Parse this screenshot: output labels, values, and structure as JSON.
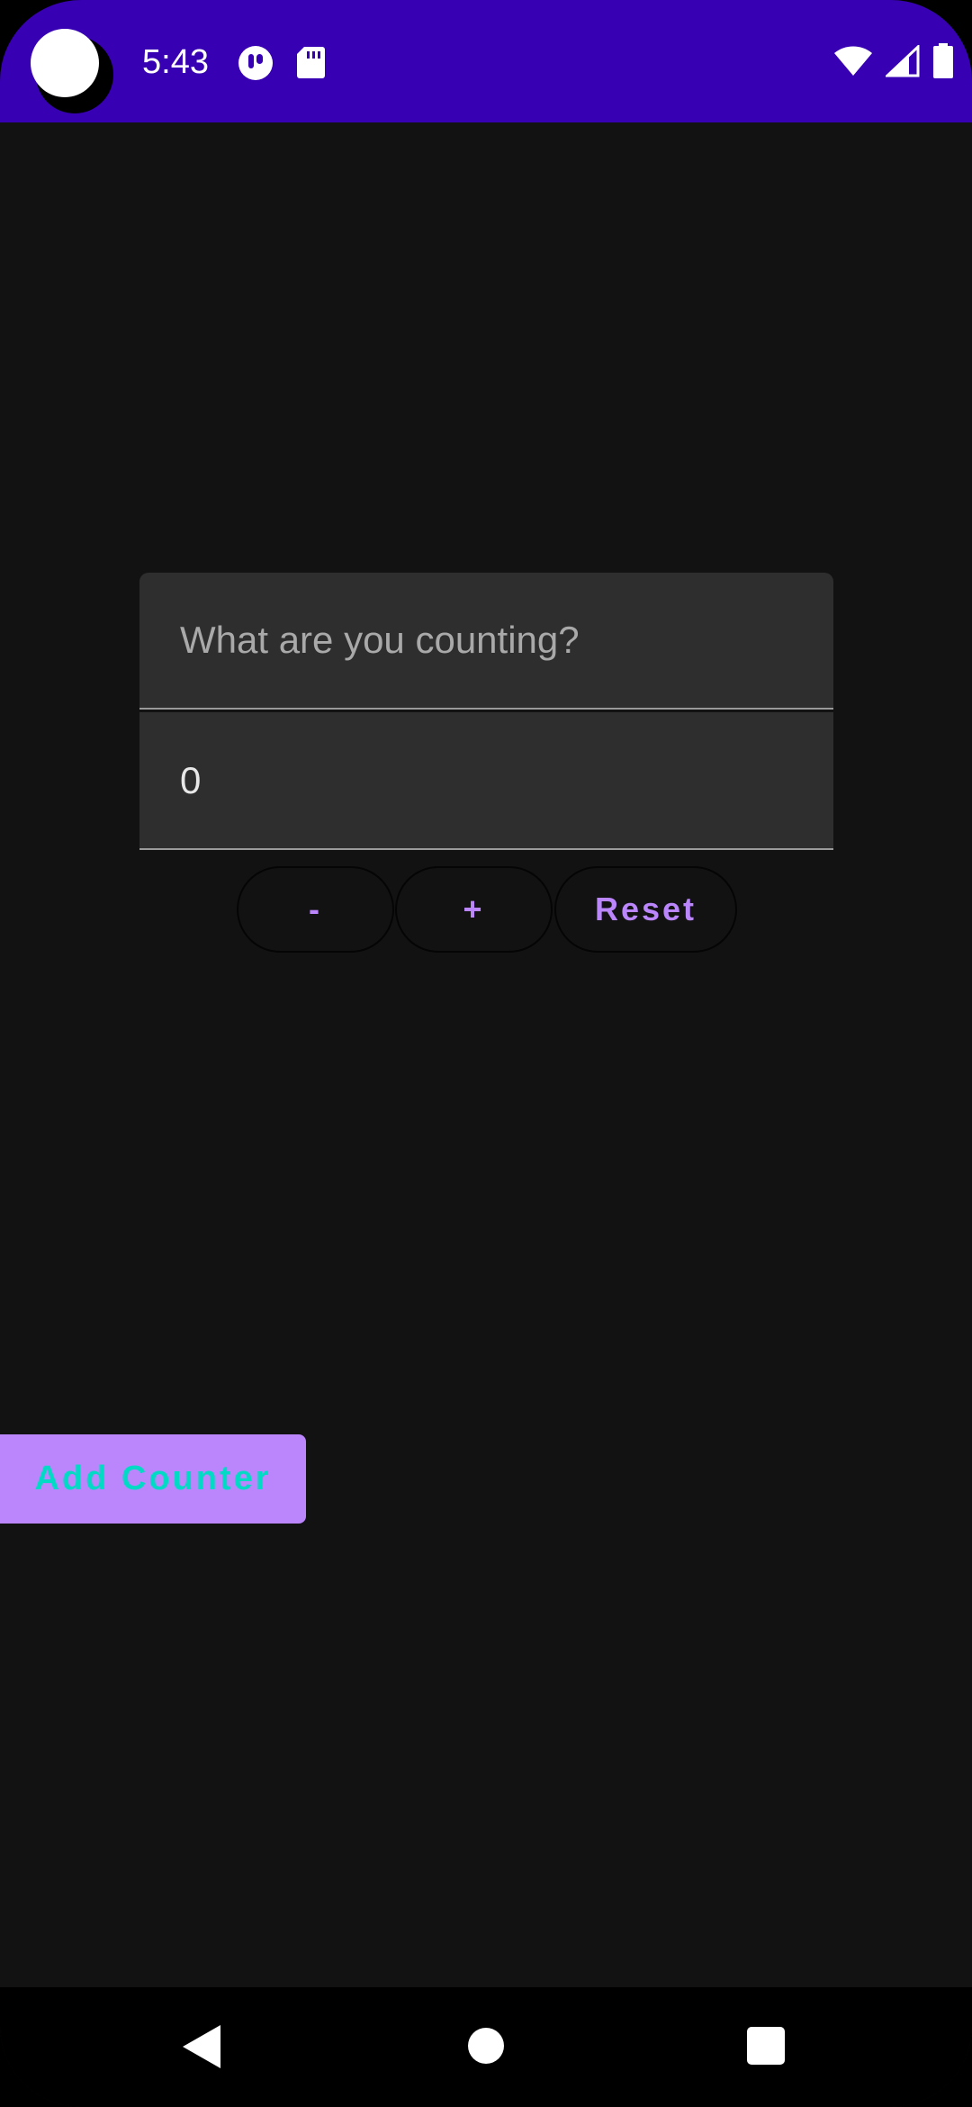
{
  "status_bar": {
    "time": "5:43",
    "background_color": "#3700b3",
    "left_icons": [
      "camera-cutout",
      "notification-icon",
      "sd-card-icon"
    ],
    "right_icons": [
      "wifi-icon",
      "cell-signal-icon",
      "battery-icon"
    ]
  },
  "counter": {
    "name_placeholder": "What are you counting?",
    "name_value": "",
    "count_value": "0",
    "minus_label": "-",
    "plus_label": "+",
    "reset_label": "Reset"
  },
  "add_counter": {
    "label": "Add Counter"
  },
  "colors": {
    "background": "#121212",
    "primary": "#bb86fc",
    "secondary": "#03dac5",
    "status_bar": "#3700b3",
    "field": "#2e2e2e"
  },
  "nav_bar": {
    "buttons": [
      "back-icon",
      "home-icon",
      "recents-icon"
    ]
  }
}
